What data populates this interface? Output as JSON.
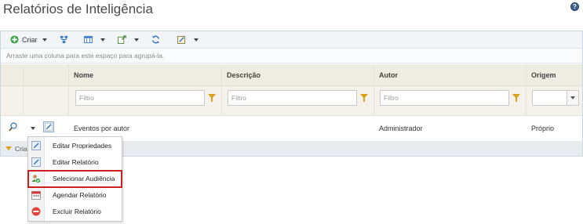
{
  "page": {
    "title": "Relatórios de Inteligência",
    "help_icon": "help-icon"
  },
  "toolbar": {
    "create_label": "Criar",
    "buttons": [
      {
        "icon": "add-circle-icon",
        "label": "Criar",
        "has_dropdown": true
      },
      {
        "icon": "hierarchy-icon",
        "label": "",
        "has_dropdown": false
      },
      {
        "icon": "columns-icon",
        "label": "",
        "has_dropdown": true
      },
      {
        "icon": "export-icon",
        "label": "",
        "has_dropdown": true
      },
      {
        "icon": "refresh-icon",
        "label": "",
        "has_dropdown": false
      },
      {
        "icon": "edit-layout-icon",
        "label": "",
        "has_dropdown": true
      }
    ]
  },
  "grid": {
    "group_hint": "Arraste uma coluna para este espaço para agrupá-la.",
    "columns": [
      "Nome",
      "Descrição",
      "Autor",
      "Origem"
    ],
    "filter_placeholder": "Filtro",
    "rows": [
      {
        "nome": "Eventos por autor",
        "descricao": "",
        "autor": "Administrador",
        "origem": "Próprio"
      }
    ],
    "footer_text": "Cria"
  },
  "context_menu": {
    "items": [
      {
        "icon": "edit-properties-icon",
        "label": "Editar Propriedades",
        "highlighted": false
      },
      {
        "icon": "edit-report-icon",
        "label": "Editar Relatório",
        "highlighted": false
      },
      {
        "icon": "audience-icon",
        "label": "Selecionar Audiência",
        "highlighted": true
      },
      {
        "icon": "calendar-icon",
        "label": "Agendar Relatório",
        "highlighted": false
      },
      {
        "icon": "delete-icon",
        "label": "Excluir Relatório",
        "highlighted": false
      }
    ]
  },
  "colors": {
    "accent_red": "#cc1f1f",
    "filter_funnel": "#d8a21c",
    "header_bg": "#efece2"
  }
}
